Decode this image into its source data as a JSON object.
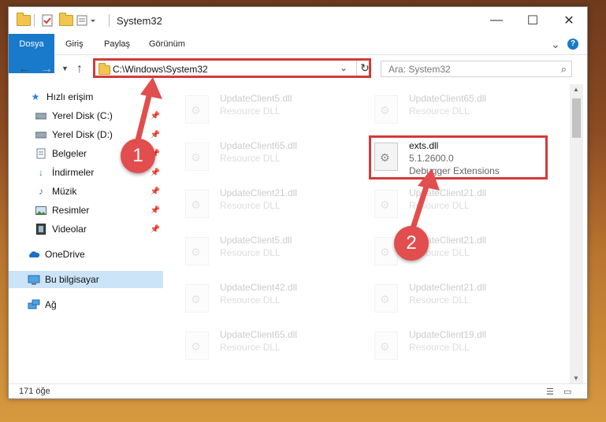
{
  "window": {
    "title": "System32",
    "controls": {
      "minimize": "—",
      "maximize": "☐",
      "close": "✕"
    }
  },
  "ribbon": {
    "tabs": [
      "Dosya",
      "Giriş",
      "Paylaş",
      "Görünüm"
    ],
    "expand": "⌄",
    "help": "?"
  },
  "address": {
    "path": "C:\\Windows\\System32",
    "search_placeholder": "Ara: System32"
  },
  "nav": {
    "items": [
      {
        "label": "Hızlı erişim",
        "icon": "star-icon"
      },
      {
        "label": "Yerel Disk (C:)",
        "icon": "drive-icon"
      },
      {
        "label": "Yerel Disk (D:)",
        "icon": "drive-icon"
      },
      {
        "label": "Belgeler",
        "icon": "documents-icon"
      },
      {
        "label": "İndirmeler",
        "icon": "download-icon"
      },
      {
        "label": "Müzik",
        "icon": "music-icon"
      },
      {
        "label": "Resimler",
        "icon": "pictures-icon"
      },
      {
        "label": "Videolar",
        "icon": "videos-icon"
      },
      {
        "label": "OneDrive",
        "icon": "cloud-icon"
      },
      {
        "label": "Bu bilgisayar",
        "icon": "computer-icon"
      },
      {
        "label": "Ağ",
        "icon": "network-icon"
      }
    ]
  },
  "files": {
    "left": [
      {
        "name": "UpdateClient5.dll",
        "desc": "Resource DLL"
      },
      {
        "name": "UpdateClient65.dll",
        "desc": "Resource DLL"
      },
      {
        "name": "UpdateClient21.dll",
        "desc": "Resource DLL"
      },
      {
        "name": "UpdateClient5.dll",
        "desc": "Resource DLL"
      },
      {
        "name": "UpdateClient42.dll",
        "desc": "Resource DLL"
      },
      {
        "name": "UpdateClient65.dll",
        "desc": "Resource DLL"
      }
    ],
    "right": [
      {
        "name": "UpdateClient65.dll",
        "desc": "Resource DLL"
      },
      {
        "name": "UpdateClient21.dll",
        "desc": "Resource DLL"
      },
      {
        "name": "UpdateClient21.dll",
        "desc": "Resource DLL"
      },
      {
        "name": "UpdateClient21.dll",
        "desc": "Resource DLL"
      },
      {
        "name": "UpdateClient19.dll",
        "desc": "Resource DLL"
      }
    ],
    "highlighted": {
      "name": "exts.dll",
      "version": "5.1.2600.0",
      "desc": "Debugger Extensions"
    }
  },
  "status": {
    "count": "171 öğe"
  },
  "annotations": {
    "badge1": "1",
    "badge2": "2",
    "color": "#e24d4d"
  }
}
